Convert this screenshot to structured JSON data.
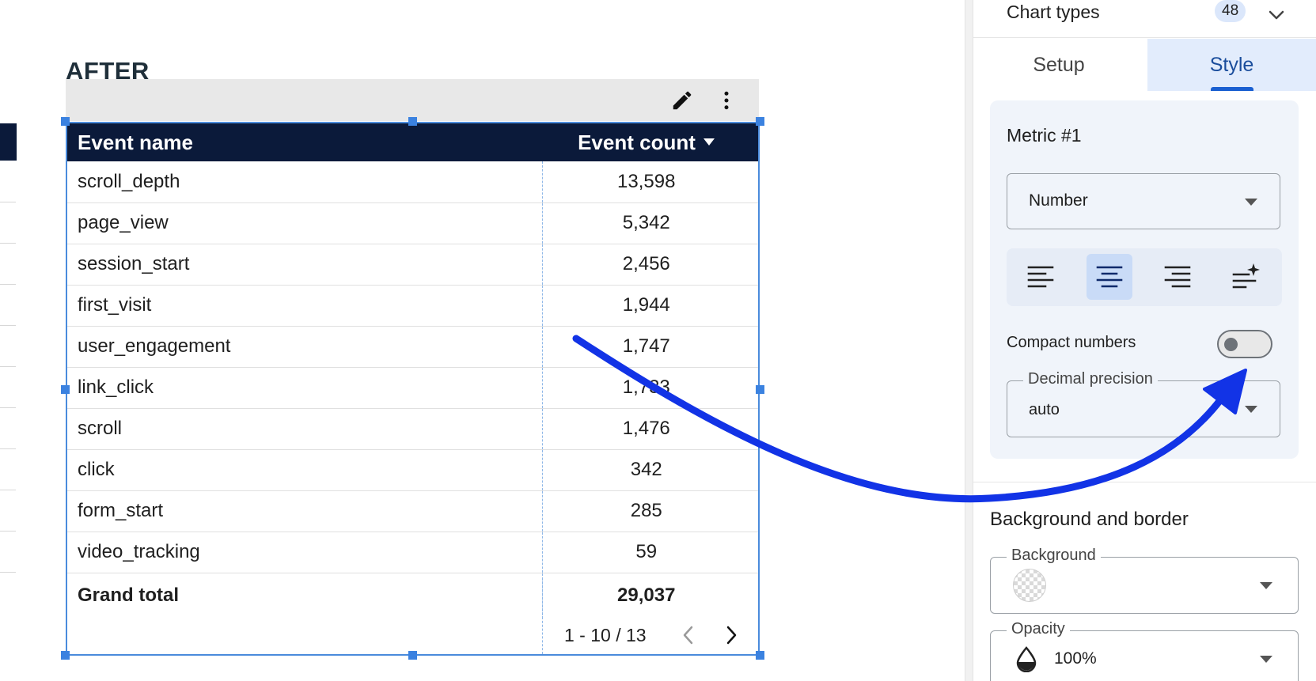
{
  "heading": "AFTER",
  "table": {
    "columns": {
      "name": "Event name",
      "count": "Event count"
    },
    "rows": [
      {
        "name": "scroll_depth",
        "count": "13,598"
      },
      {
        "name": "page_view",
        "count": "5,342"
      },
      {
        "name": "session_start",
        "count": "2,456"
      },
      {
        "name": "first_visit",
        "count": "1,944"
      },
      {
        "name": "user_engagement",
        "count": "1,747"
      },
      {
        "name": "link_click",
        "count": "1,733"
      },
      {
        "name": "scroll",
        "count": "1,476"
      },
      {
        "name": "click",
        "count": "342"
      },
      {
        "name": "form_start",
        "count": "285"
      },
      {
        "name": "video_tracking",
        "count": "59"
      }
    ],
    "total": {
      "label": "Grand total",
      "count": "29,037"
    },
    "pagination": "1 - 10 / 13"
  },
  "panel": {
    "chart_types_label": "Chart types",
    "chart_types_count": "48",
    "tabs": {
      "setup": "Setup",
      "style": "Style"
    },
    "metric": {
      "title": "Metric #1",
      "format": "Number",
      "compact_label": "Compact numbers",
      "decimal_label": "Decimal precision",
      "decimal_value": "auto"
    },
    "background_border": {
      "title": "Background and border",
      "background_label": "Background",
      "opacity_label": "Opacity",
      "opacity_value": "100%"
    }
  },
  "colors": {
    "header_bg": "#0b1a3a",
    "selection": "#3b82e0",
    "annotation_arrow": "#1233e6",
    "tab_active_bg": "#e2ecfc"
  }
}
